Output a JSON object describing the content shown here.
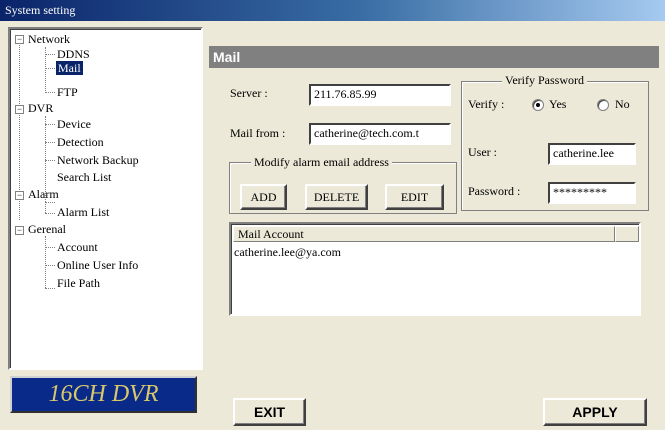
{
  "window": {
    "title": "System setting"
  },
  "tree": {
    "groups": [
      {
        "label": "Network",
        "children": [
          "DDNS",
          "Mail",
          "FTP"
        ]
      },
      {
        "label": "DVR",
        "children": [
          "Device",
          "Detection",
          "Network Backup",
          "Search List"
        ]
      },
      {
        "label": "Alarm",
        "children": [
          "Alarm List"
        ]
      },
      {
        "label": "Gerenal",
        "children": [
          "Account",
          "Online User Info",
          "File Path"
        ]
      }
    ],
    "selected": "Mail",
    "expander_symbol": "−"
  },
  "logo": {
    "text": "16CH DVR"
  },
  "panel": {
    "title": "Mail",
    "server": {
      "label": "Server :",
      "value": "211.76.85.99"
    },
    "mail_from": {
      "label": "Mail from :",
      "value": "catherine@tech.com.t"
    },
    "modify_group": {
      "legend": "Modify alarm email address",
      "add_label": "ADD",
      "delete_label": "DELETE",
      "edit_label": "EDIT"
    },
    "verify_group": {
      "legend": "Verify Password",
      "verify_label": "Verify :",
      "yes_label": "Yes",
      "no_label": "No",
      "selected": "Yes",
      "user_label": "User :",
      "user_value": "catherine.lee",
      "password_label": "Password :",
      "password_value": "*********"
    },
    "mail_list": {
      "column_header": "Mail Account",
      "items": [
        "catherine.lee@ya.com"
      ]
    }
  },
  "footer": {
    "exit_label": "EXIT",
    "apply_label": "APPLY"
  },
  "colors": {
    "title_start": "#0a246a",
    "title_end": "#a6caf0",
    "selection": "#0a246a",
    "logo_bg": "#0a2a8a",
    "logo_text": "#d8c86a"
  }
}
